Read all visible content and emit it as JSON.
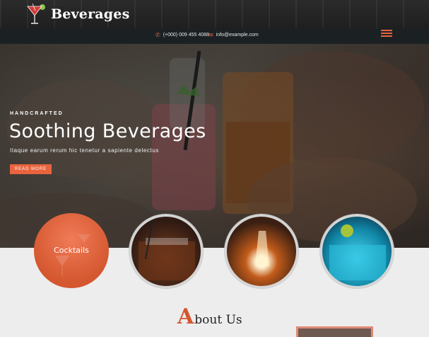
{
  "header": {
    "logo_text": "Beverages",
    "logo_icon": "cocktail-glass-icon",
    "menu_icon": "hamburger-menu-icon"
  },
  "contact": {
    "phone": "(+000) 009 455 4088",
    "phone_icon": "phone-icon",
    "email": "info@example.com",
    "email_icon": "envelope-icon"
  },
  "hero": {
    "eyebrow": "HANDCRAFTED",
    "title": "Soothing Beverages",
    "subtitle": "Itaque earum rerum hic tenetur a sapiente delectus",
    "button_label": "READ MORE"
  },
  "categories": {
    "first_label": "Cocktails"
  },
  "about": {
    "initial": "A",
    "rest": "bout Us"
  },
  "colors": {
    "accent": "#e8643f",
    "dark": "#1b2123"
  }
}
